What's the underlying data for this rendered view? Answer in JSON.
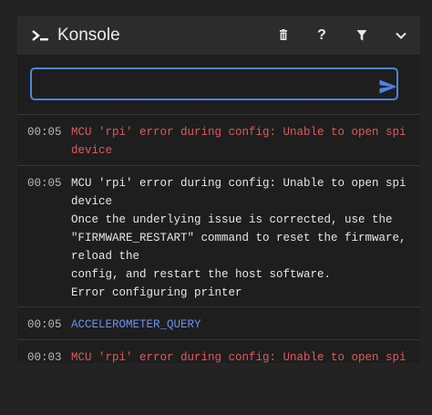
{
  "app": {
    "title": "Konsole"
  },
  "header": {
    "buttons": [
      {
        "icon": "trash-icon",
        "label": ""
      },
      {
        "icon": "help-icon",
        "label": "?"
      },
      {
        "icon": "filter-icon",
        "label": ""
      },
      {
        "icon": "chevron-down-icon",
        "label": ""
      }
    ]
  },
  "input": {
    "value": "",
    "placeholder": ""
  },
  "log": [
    {
      "time": "00:05",
      "kind": "error",
      "text": "MCU 'rpi' error during config: Unable to open spi device"
    },
    {
      "time": "00:05",
      "kind": "normal",
      "text": "MCU 'rpi' error during config: Unable to open spi device\nOnce the underlying issue is corrected, use the \"FIRMWARE_RESTART\" command to reset the firmware, reload the\nconfig, and restart the host software.\nError configuring printer"
    },
    {
      "time": "00:05",
      "kind": "command",
      "text": "ACCELEROMETER_QUERY"
    },
    {
      "time": "00:03",
      "kind": "error",
      "text": "MCU 'rpi' error during config: Unable to open spi"
    }
  ],
  "colors": {
    "accent": "#4d84e2",
    "error": "#e05a5a",
    "command": "#6d8ff0",
    "header": "#2c2c2c",
    "panel": "#1e1e1e"
  }
}
